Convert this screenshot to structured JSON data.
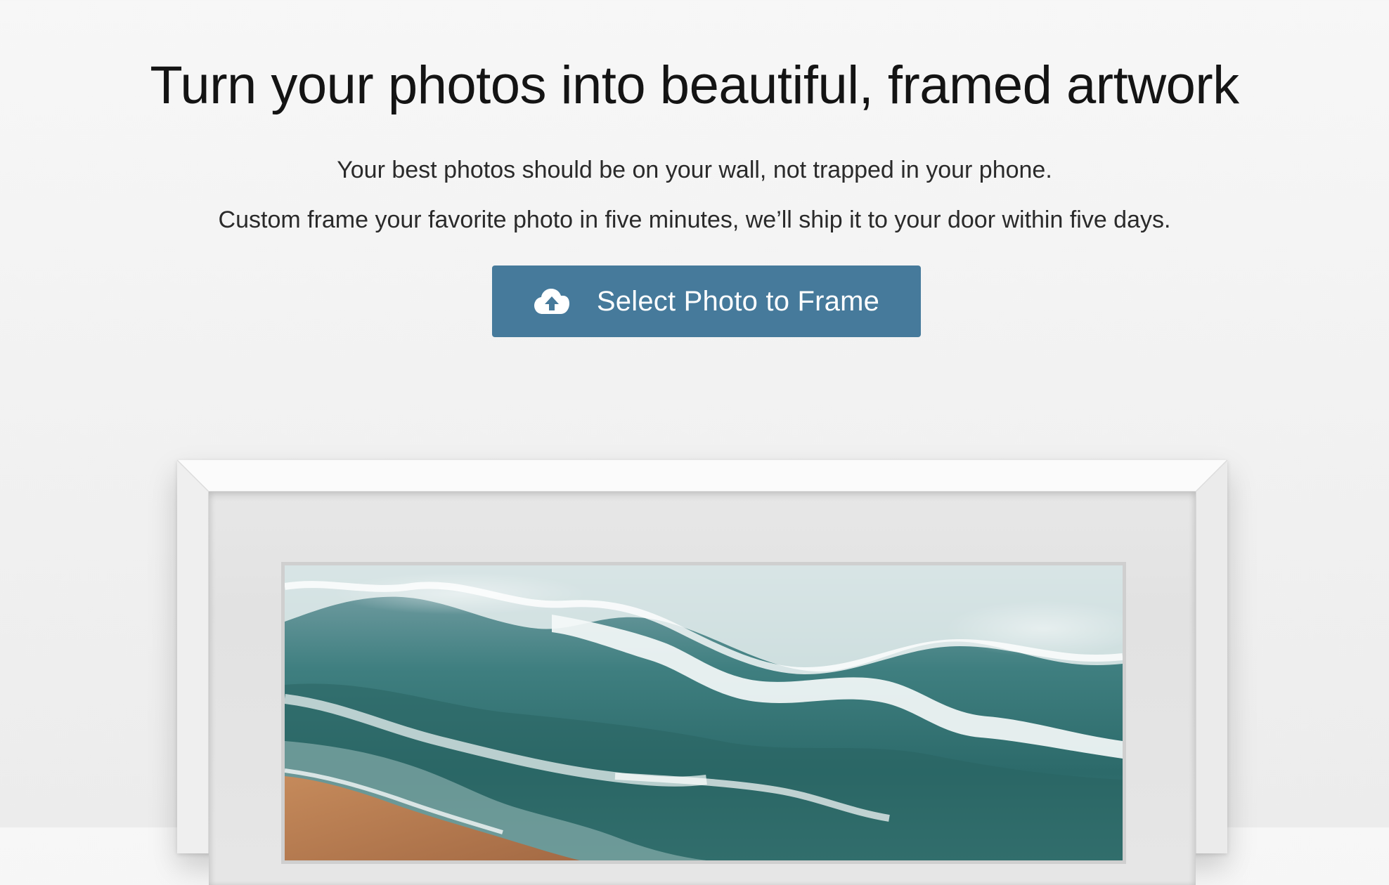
{
  "hero": {
    "headline": "Turn your photos into beautiful, framed artwork",
    "subline_1": "Your best photos should be on your wall, not trapped in your phone.",
    "subline_2": "Custom frame your favorite photo in five minutes, we’ll ship it to your door within five days."
  },
  "cta": {
    "label": "Select Photo to Frame",
    "icon": "cloud-upload-icon"
  },
  "colors": {
    "cta_background": "#467a9b",
    "page_background": "#f4f4f4",
    "frame": "#f7f7f7",
    "mat": "#e4e4e4"
  },
  "artwork": {
    "subject": "beach-waves-photo"
  }
}
